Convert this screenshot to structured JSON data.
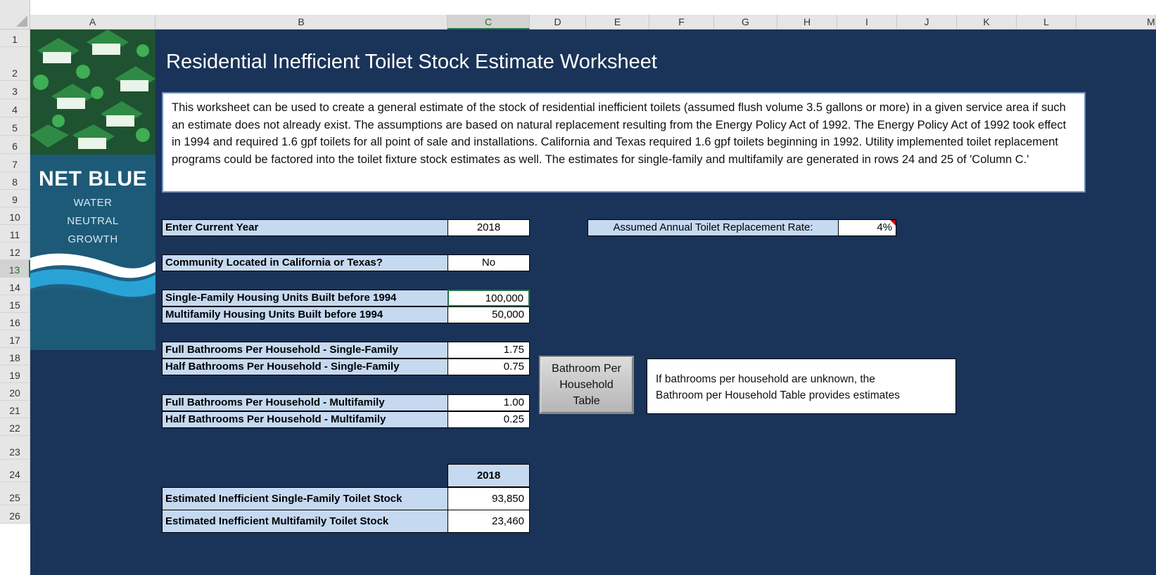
{
  "spreadsheet": {
    "columns": [
      "A",
      "B",
      "C",
      "D",
      "E",
      "F",
      "G",
      "H",
      "I",
      "J",
      "K",
      "L",
      "M"
    ],
    "rows": [
      "1",
      "2",
      "3",
      "4",
      "5",
      "6",
      "7",
      "8",
      "9",
      "10",
      "11",
      "12",
      "13",
      "14",
      "15",
      "16",
      "17",
      "18",
      "19",
      "20",
      "21",
      "22",
      "23",
      "24",
      "25",
      "26"
    ],
    "selected_cell": "C13"
  },
  "brand": {
    "title": "NET BLUE",
    "line1": "WATER",
    "line2": "NEUTRAL",
    "line3": "GROWTH"
  },
  "worksheet": {
    "title": "Residential Inefficient Toilet Stock Estimate Worksheet",
    "description": "This worksheet can be used to create a general estimate of the stock of residential inefficient toilets (assumed flush volume 3.5 gallons or more) in a given service area if such an estimate does not already exist.  The assumptions are based on natural replacement resulting from the Energy Policy Act of 1992.  The Energy Policy Act of 1992 took effect in 1994 and required 1.6 gpf toilets for all point of sale and installations. California and Texas required 1.6 gpf toilets beginning in 1992. Utility implemented toilet replacement programs could be factored into the toilet fixture stock estimates as well.  The estimates for single-family and multifamily are generated in rows 24 and 25 of 'Column C.'"
  },
  "inputs": {
    "current_year": {
      "label": "Enter Current Year",
      "value": "2018"
    },
    "ca_tx": {
      "label": "Community Located in California or Texas?",
      "value": "No"
    },
    "sf_units": {
      "label": "Single-Family Housing Units Built before 1994",
      "value": "100,000"
    },
    "mf_units": {
      "label": "Multifamily Housing Units Built before 1994",
      "value": "50,000"
    },
    "sf_full_bath": {
      "label": "Full Bathrooms Per Household - Single-Family",
      "value": "1.75"
    },
    "sf_half_bath": {
      "label": "Half Bathrooms Per Household - Single-Family",
      "value": "0.75"
    },
    "mf_full_bath": {
      "label": "Full Bathrooms Per Household - Multifamily",
      "value": "1.00"
    },
    "mf_half_bath": {
      "label": "Half Bathrooms Per Household - Multifamily",
      "value": "0.25"
    }
  },
  "replacement_rate": {
    "label": "Assumed Annual Toilet Replacement Rate:",
    "value": "4%"
  },
  "bathroom_button": {
    "line1": "Bathroom Per",
    "line2": "Household",
    "line3": "Table"
  },
  "bathroom_note": {
    "line1": "If bathrooms per household are unknown, the",
    "line2": "Bathroom per Household Table provides estimates"
  },
  "results": {
    "year_header": "2018",
    "sf_stock": {
      "label": "Estimated Inefficient Single-Family Toilet Stock",
      "value": "93,850"
    },
    "mf_stock": {
      "label": "Estimated Inefficient Multifamily Toilet Stock",
      "value": "23,460"
    }
  },
  "colors": {
    "sheet_background": "#1a3358",
    "label_fill": "#c5d9f1",
    "brand_panel": "#1d5a78",
    "selection": "#217346"
  }
}
